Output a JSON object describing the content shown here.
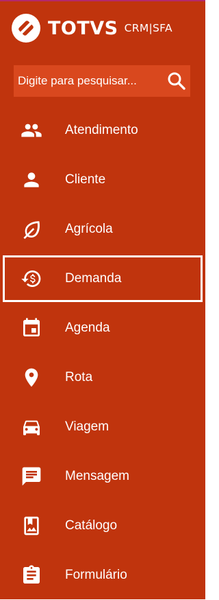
{
  "colors": {
    "accent_stripe": "#b4286a",
    "sidebar_bg": "#c0340d",
    "search_bg": "#d9481e",
    "text": "#ffffff"
  },
  "brand": {
    "name": "TOTVS",
    "product": "CRM|SFA",
    "logo_icon": "totvs-logo-icon"
  },
  "search": {
    "placeholder": "Digite para pesquisar...",
    "value": "",
    "icon": "search-icon"
  },
  "menu": {
    "selected_index": 3,
    "items": [
      {
        "label": "Atendimento",
        "icon": "people-icon"
      },
      {
        "label": "Cliente",
        "icon": "person-icon"
      },
      {
        "label": "Agrícola",
        "icon": "leaf-icon"
      },
      {
        "label": "Demanda",
        "icon": "money-history-icon"
      },
      {
        "label": "Agenda",
        "icon": "calendar-icon"
      },
      {
        "label": "Rota",
        "icon": "location-pin-icon"
      },
      {
        "label": "Viagem",
        "icon": "car-icon"
      },
      {
        "label": "Mensagem",
        "icon": "message-icon"
      },
      {
        "label": "Catálogo",
        "icon": "catalog-icon"
      },
      {
        "label": "Formulário",
        "icon": "clipboard-icon"
      }
    ]
  }
}
